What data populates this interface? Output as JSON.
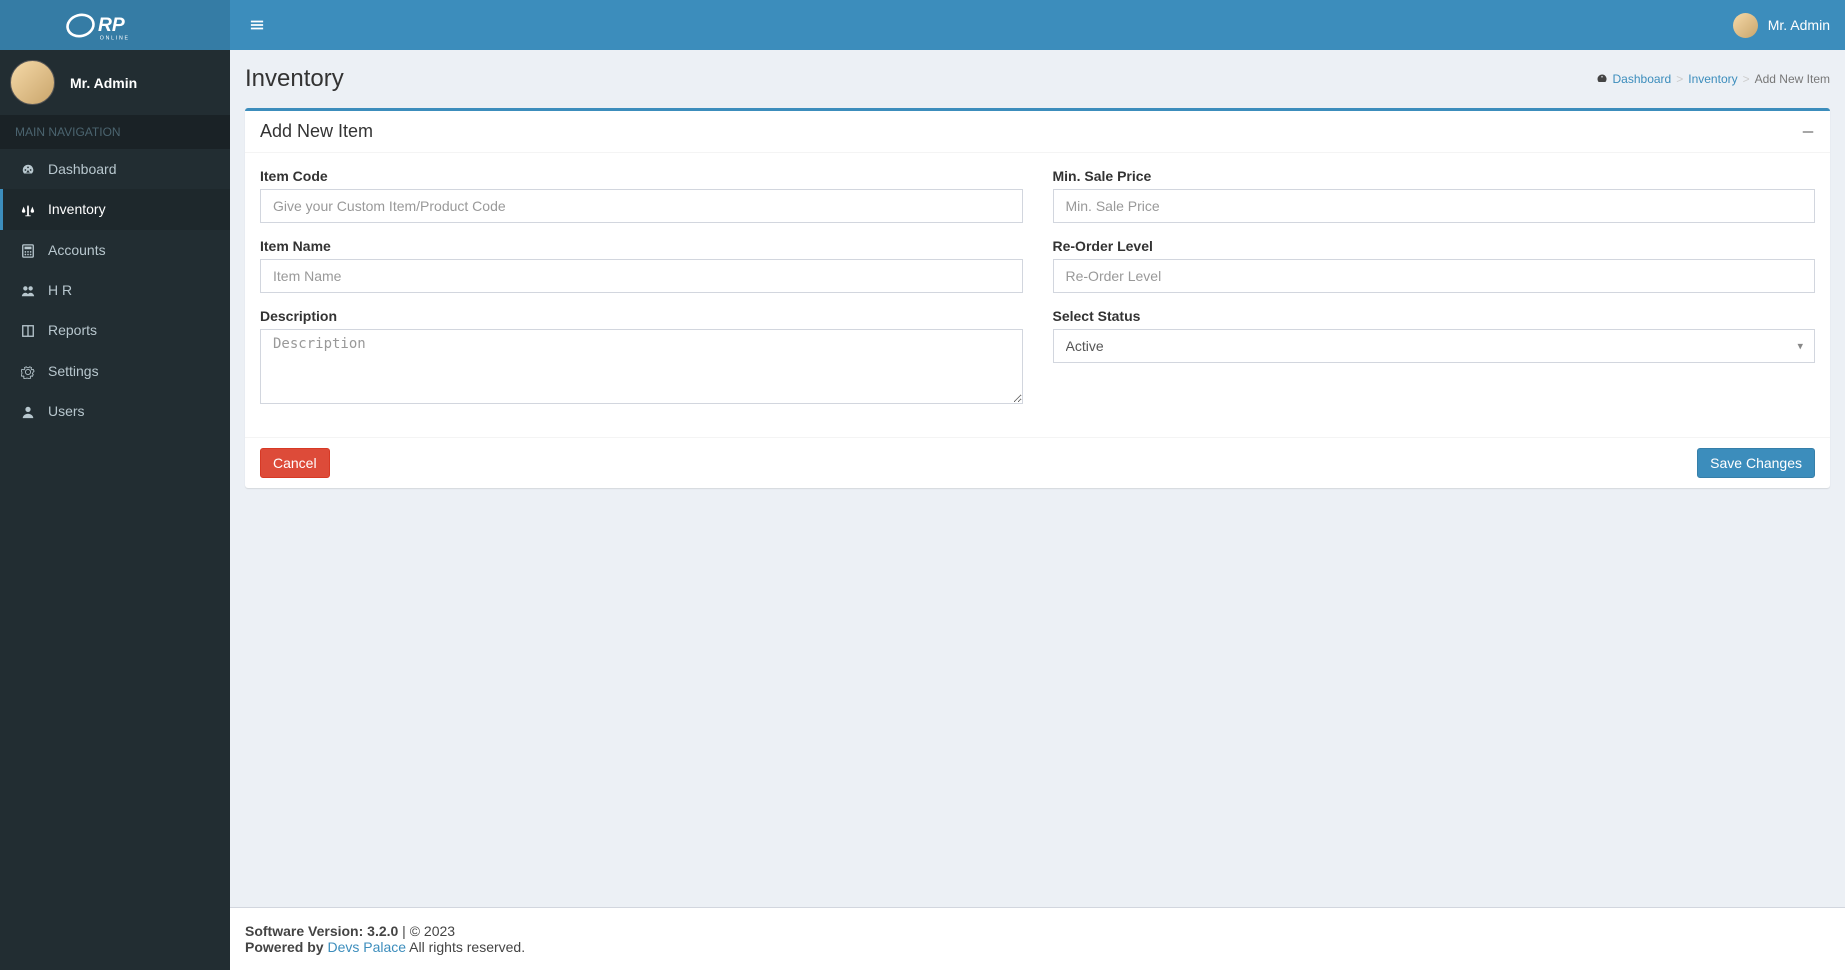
{
  "app": {
    "logo_text": "ERP",
    "logo_sub": "ONLINE"
  },
  "header": {
    "user_name": "Mr. Admin"
  },
  "sidebar": {
    "user_name": "Mr. Admin",
    "section_label": "MAIN NAVIGATION",
    "items": [
      {
        "label": "Dashboard",
        "icon": "dashboard"
      },
      {
        "label": "Inventory",
        "icon": "balance",
        "active": true
      },
      {
        "label": "Accounts",
        "icon": "calculator"
      },
      {
        "label": "H R",
        "icon": "users"
      },
      {
        "label": "Reports",
        "icon": "book"
      },
      {
        "label": "Settings",
        "icon": "gear"
      },
      {
        "label": "Users",
        "icon": "user"
      }
    ]
  },
  "page": {
    "title": "Inventory",
    "breadcrumb": {
      "dashboard": "Dashboard",
      "inventory": "Inventory",
      "current": "Add New Item"
    }
  },
  "box": {
    "title": "Add New Item"
  },
  "form": {
    "item_code": {
      "label": "Item Code",
      "placeholder": "Give your Custom Item/Product Code",
      "value": ""
    },
    "item_name": {
      "label": "Item Name",
      "placeholder": "Item Name",
      "value": ""
    },
    "description": {
      "label": "Description",
      "placeholder": "Description",
      "value": ""
    },
    "min_sale_price": {
      "label": "Min. Sale Price",
      "placeholder": "Min. Sale Price",
      "value": ""
    },
    "reorder_level": {
      "label": "Re-Order Level",
      "placeholder": "Re-Order Level",
      "value": ""
    },
    "status": {
      "label": "Select Status",
      "selected": "Active"
    }
  },
  "buttons": {
    "cancel": "Cancel",
    "save": "Save Changes"
  },
  "footer": {
    "version_label": "Software Version: ",
    "version": "3.2.0",
    "copyright": " | © 2023",
    "powered_by": "Powered by ",
    "company": "Devs Palace",
    "rights": " All rights reserved."
  }
}
